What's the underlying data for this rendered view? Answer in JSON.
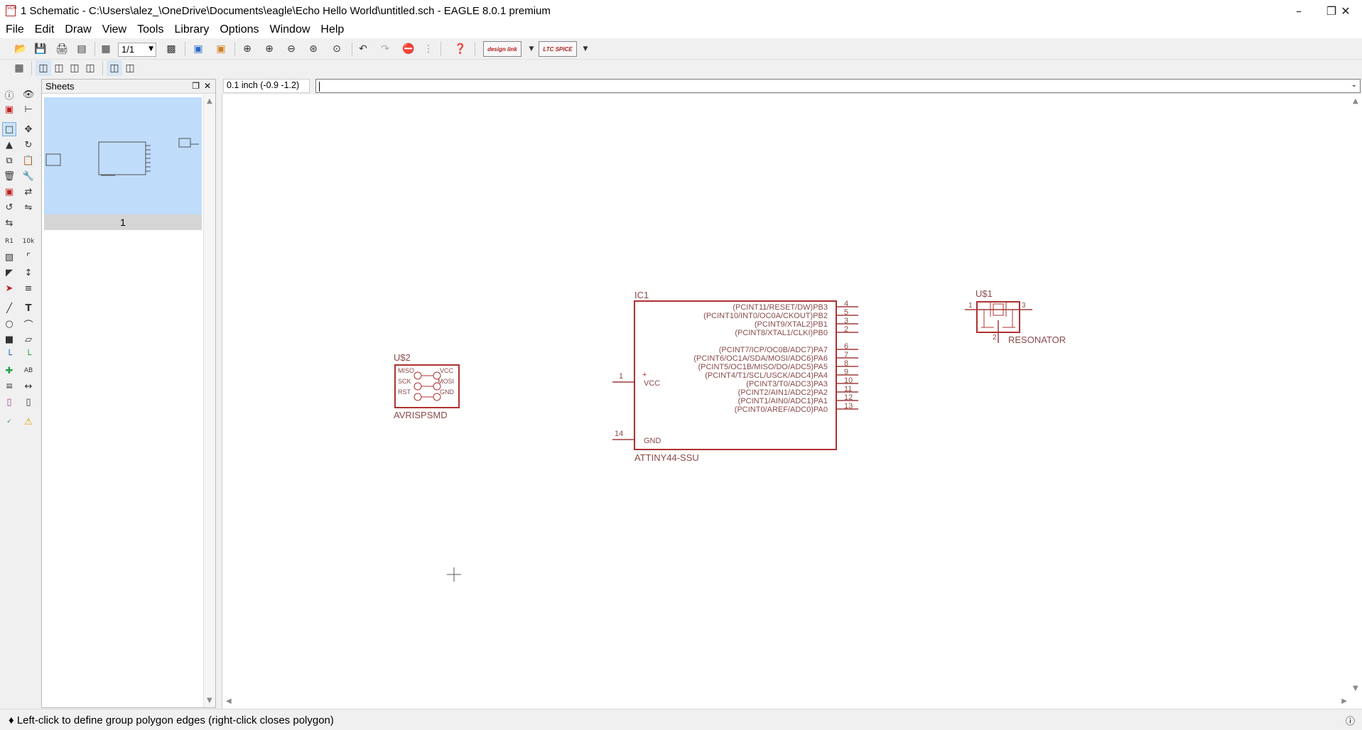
{
  "window": {
    "title": "1 Schematic - C:\\Users\\alez_\\OneDrive\\Documents\\eagle\\Echo Hello World\\untitled.sch - EAGLE 8.0.1 premium",
    "app_icon_text": "SCH"
  },
  "menu": [
    {
      "label": "File"
    },
    {
      "label": "Edit"
    },
    {
      "label": "Draw"
    },
    {
      "label": "View"
    },
    {
      "label": "Tools"
    },
    {
      "label": "Library"
    },
    {
      "label": "Options"
    },
    {
      "label": "Window"
    },
    {
      "label": "Help"
    }
  ],
  "toolbar": {
    "sheet_select_value": "1/1",
    "designlink_label": "design link",
    "ltspice_label": "LTC SPICE"
  },
  "sheets_panel": {
    "title": "Sheets",
    "sheet_number": "1"
  },
  "command_bar": {
    "coordinate": "0.1 inch (-0.9 -1.2)",
    "command_text": ""
  },
  "schematic": {
    "ic1": {
      "name": "IC1",
      "value": "ATTINY44-SSU",
      "left_pins": [
        {
          "num": "1",
          "label": "VCC"
        },
        {
          "num": "14",
          "label": "GND"
        }
      ],
      "right_pins": [
        {
          "num": "4",
          "label": "(PCINT11/RESET/DW)PB3"
        },
        {
          "num": "5",
          "label": "(PCINT10/INT0/OC0A/CKOUT)PB2"
        },
        {
          "num": "3",
          "label": "(PCINT9/XTAL2)PB1"
        },
        {
          "num": "2",
          "label": "(PCINT8/XTAL1/CLKI)PB0"
        },
        {
          "num": "6",
          "label": "(PCINT7/ICP/OC0B/ADC7)PA7"
        },
        {
          "num": "7",
          "label": "(PCINT6/OC1A/SDA/MOSI/ADC6)PA6"
        },
        {
          "num": "8",
          "label": "(PCINT5/OC1B/MISO/DO/ADC5)PA5"
        },
        {
          "num": "9",
          "label": "(PCINT4/T1/SCL/USCK/ADC4)PA4"
        },
        {
          "num": "10",
          "label": "(PCINT3/T0/ADC3)PA3"
        },
        {
          "num": "11",
          "label": "(PCINT2/AIN1/ADC2)PA2"
        },
        {
          "num": "12",
          "label": "(PCINT1/AIN0/ADC1)PA1"
        },
        {
          "num": "13",
          "label": "(PCINT0/AREF/ADC0)PA0"
        }
      ]
    },
    "u2": {
      "name": "U$2",
      "value": "AVRISPSMD",
      "pins_left": [
        "MISO",
        "SCK",
        "RST"
      ],
      "pins_right": [
        "VCC",
        "MOSI",
        "GND"
      ]
    },
    "u1": {
      "name": "U$1",
      "value": "RESONATOR",
      "pin_left": "1",
      "pin_right": "3",
      "pin_bottom": "2"
    }
  },
  "status": {
    "message": "♦ Left-click to define group polygon edges (right-click closes polygon)"
  },
  "colors": {
    "symbol": "#b03030",
    "pin": "#a03a3a",
    "label_text": "#8a4a4a",
    "selection_bg": "#bfdcfb"
  }
}
